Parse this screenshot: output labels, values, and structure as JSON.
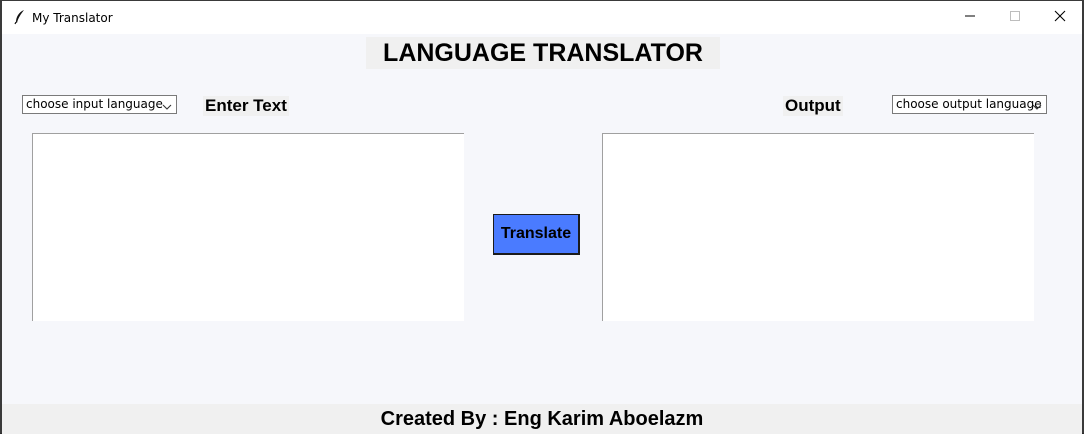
{
  "window": {
    "title": "My Translator",
    "app_icon": "feather-icon",
    "controls": [
      "minimize-icon",
      "maximize-icon",
      "close-icon"
    ]
  },
  "header": {
    "title": "LANGUAGE TRANSLATOR"
  },
  "input": {
    "language_select": "choose input language",
    "label": "Enter Text",
    "text": ""
  },
  "output": {
    "language_select": "choose output language",
    "label": "Output",
    "text": ""
  },
  "actions": {
    "translate_label": "Translate"
  },
  "footer": {
    "credit": "Created By : Eng Karim Aboelazm"
  },
  "colors": {
    "translate_button": "#4a7bff",
    "background": "#f6f7fb",
    "label_background": "#f0f0f0"
  }
}
